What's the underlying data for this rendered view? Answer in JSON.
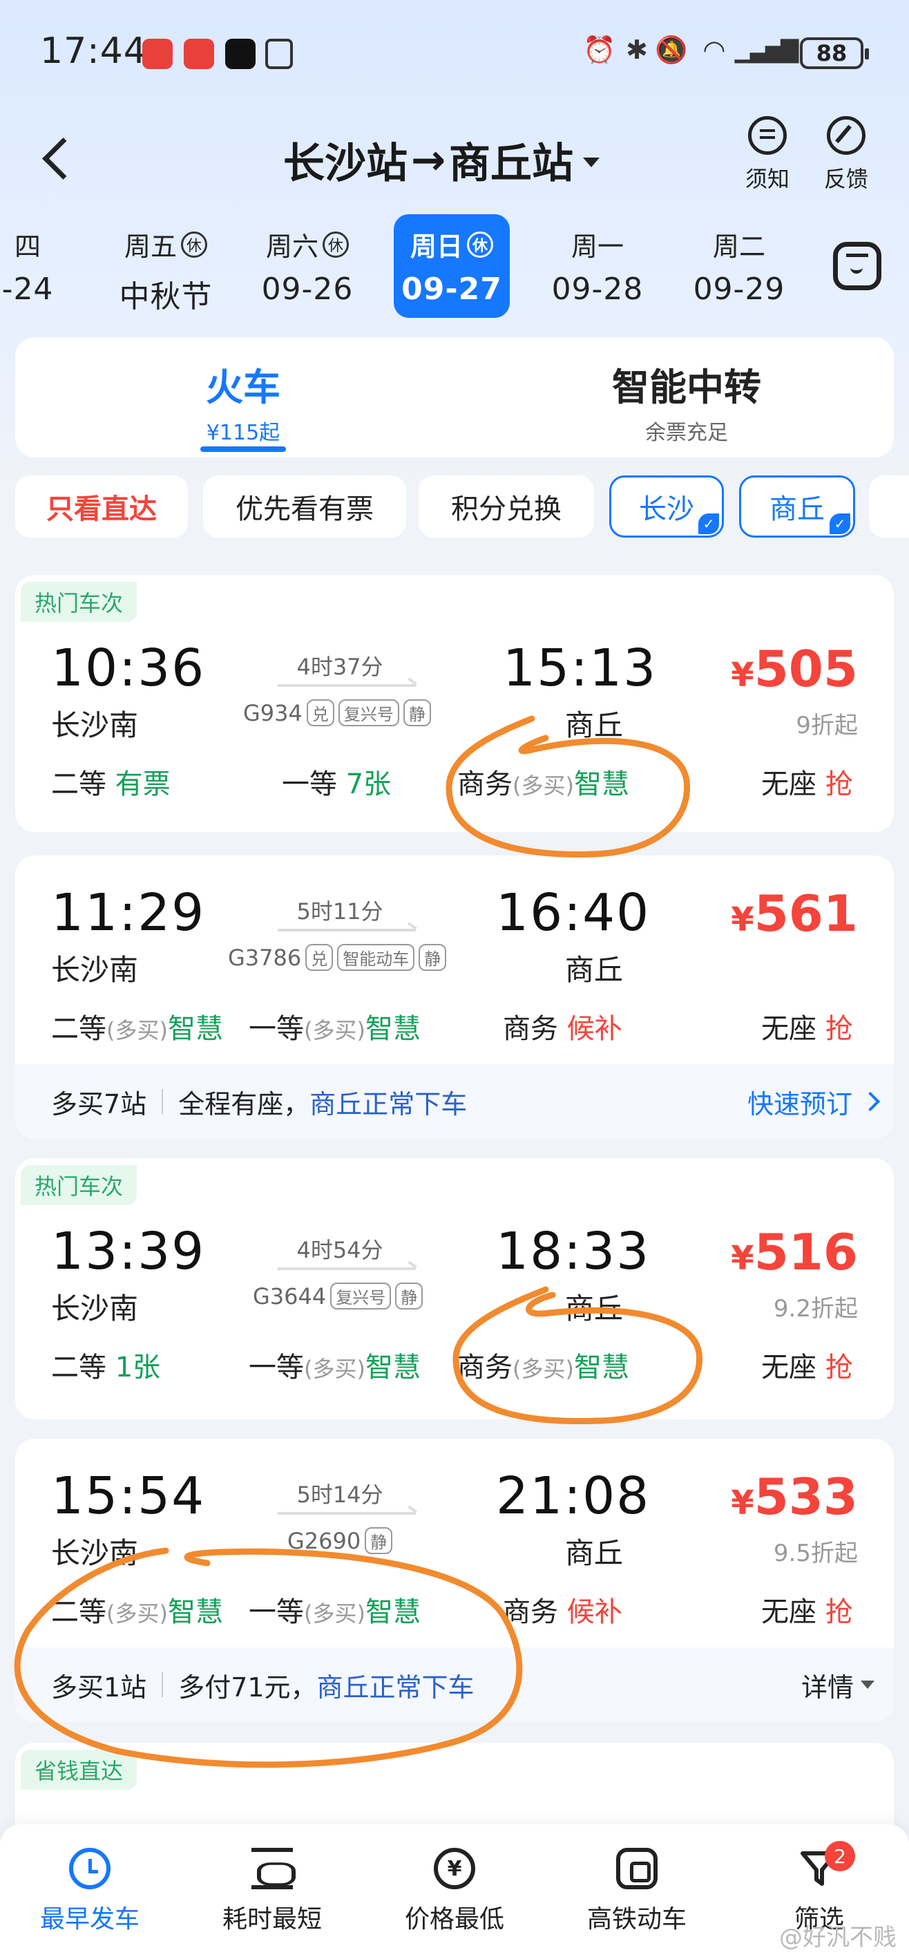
{
  "status": {
    "time": "17:44",
    "battery": "88"
  },
  "header": {
    "from": "长沙站",
    "arrow": "→",
    "to": "商丘站",
    "notice_label": "须知",
    "feedback_label": "反馈"
  },
  "dates": [
    {
      "weekday": "四",
      "date": "-24",
      "rest": ""
    },
    {
      "weekday": "周五",
      "date": "中秋节",
      "rest": "休"
    },
    {
      "weekday": "周六",
      "date": "09-26",
      "rest": "休"
    },
    {
      "weekday": "周日",
      "date": "09-27",
      "rest": "休"
    },
    {
      "weekday": "周一",
      "date": "09-28",
      "rest": ""
    },
    {
      "weekday": "周二",
      "date": "09-29",
      "rest": ""
    }
  ],
  "mode_tabs": [
    {
      "title": "火车",
      "sub": "¥115起"
    },
    {
      "title": "智能中转",
      "sub": "余票充足"
    }
  ],
  "filters": [
    "只看直达",
    "优先看有票",
    "积分兑换",
    "长沙",
    "商丘"
  ],
  "trains": [
    {
      "tag": "热门车次",
      "dep": "10:36",
      "dep_station": "长沙南",
      "arr": "15:13",
      "arr_station": "商丘",
      "duration": "4时37分",
      "number": "G934",
      "badges": [
        "兑",
        "复兴号",
        "静"
      ],
      "price": "505",
      "yen": "¥",
      "discount": "9折起",
      "seats": [
        {
          "name": "二等",
          "status": "有票",
          "buy": ""
        },
        {
          "name": "一等",
          "status": "7张",
          "buy": ""
        },
        {
          "name": "商务",
          "status": "智慧",
          "buy": "(多买)"
        },
        {
          "name": "无座",
          "status": "抢",
          "buy": ""
        }
      ]
    },
    {
      "tag": "",
      "dep": "11:29",
      "dep_station": "长沙南",
      "arr": "16:40",
      "arr_station": "商丘",
      "duration": "5时11分",
      "number": "G3786",
      "badges": [
        "兑",
        "智能动车",
        "静"
      ],
      "price": "561",
      "yen": "¥",
      "discount": "",
      "seats": [
        {
          "name": "二等",
          "status": "智慧",
          "buy": "(多买)"
        },
        {
          "name": "一等",
          "status": "智慧",
          "buy": "(多买)"
        },
        {
          "name": "商务",
          "status": "候补",
          "buy": ""
        },
        {
          "name": "无座",
          "status": "抢",
          "buy": ""
        }
      ],
      "extra": {
        "left": "多买7站",
        "mid": "全程有座，",
        "blue": "商丘正常下车",
        "right": "快速预订"
      }
    },
    {
      "tag": "热门车次",
      "dep": "13:39",
      "dep_station": "长沙南",
      "arr": "18:33",
      "arr_station": "商丘",
      "duration": "4时54分",
      "number": "G3644",
      "badges": [
        "复兴号",
        "静"
      ],
      "price": "516",
      "yen": "¥",
      "discount": "9.2折起",
      "seats": [
        {
          "name": "二等",
          "status": "1张",
          "buy": ""
        },
        {
          "name": "一等",
          "status": "智慧",
          "buy": "(多买)"
        },
        {
          "name": "商务",
          "status": "智慧",
          "buy": "(多买)"
        },
        {
          "name": "无座",
          "status": "抢",
          "buy": ""
        }
      ]
    },
    {
      "tag": "",
      "dep": "15:54",
      "dep_station": "长沙南",
      "arr": "21:08",
      "arr_station": "商丘",
      "duration": "5时14分",
      "number": "G2690",
      "badges": [
        "静"
      ],
      "price": "533",
      "yen": "¥",
      "discount": "9.5折起",
      "seats": [
        {
          "name": "二等",
          "status": "智慧",
          "buy": "(多买)"
        },
        {
          "name": "一等",
          "status": "智慧",
          "buy": "(多买)"
        },
        {
          "name": "商务",
          "status": "候补",
          "buy": ""
        },
        {
          "name": "无座",
          "status": "抢",
          "buy": ""
        }
      ],
      "extra": {
        "left": "多买1站",
        "mid": "多付71元，",
        "blue": "商丘正常下车",
        "right": "详情"
      }
    },
    {
      "tag": "省钱直达"
    }
  ],
  "bottom_nav": [
    {
      "label": "最早发车",
      "icon": "clock-icon"
    },
    {
      "label": "耗时最短",
      "icon": "hourglass-icon"
    },
    {
      "label": "价格最低",
      "icon": "yuan-icon"
    },
    {
      "label": "高铁动车",
      "icon": "rail-icon"
    },
    {
      "label": "筛选",
      "icon": "filter-icon"
    }
  ],
  "filter_badge": "2",
  "watermark": "@好汎不贱",
  "colors": {
    "accent": "#1677ff",
    "price": "#f5443b",
    "available": "#15a05a",
    "annotation": "#f28a2e"
  }
}
